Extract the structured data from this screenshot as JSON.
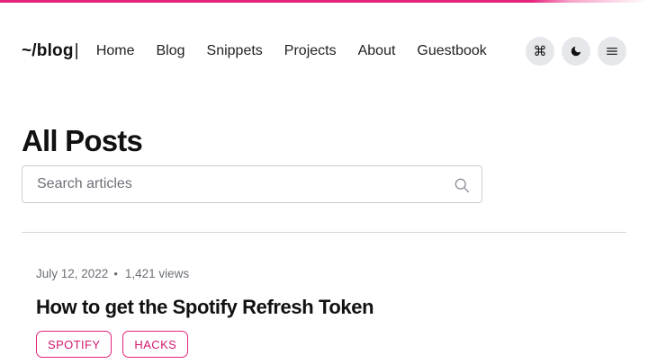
{
  "header": {
    "logo_text": "~/blog",
    "logo_cursor": "|",
    "nav": [
      "Home",
      "Blog",
      "Snippets",
      "Projects",
      "About",
      "Guestbook"
    ],
    "icons": {
      "command": "command-icon",
      "theme": "moon-icon",
      "menu": "hamburger-menu-icon"
    }
  },
  "main": {
    "title": "All Posts",
    "search": {
      "placeholder": "Search articles",
      "value": ""
    },
    "posts": [
      {
        "date": "July 12, 2022",
        "separator": "•",
        "views": "1,421 views",
        "title": "How to get the Spotify Refresh Token",
        "tags": [
          "SPOTIFY",
          "HACKS"
        ]
      }
    ]
  },
  "colors": {
    "accent": "#e4237d",
    "icon_button_bg": "#e5e7eb",
    "text": "#111111",
    "muted": "#6b6f76"
  }
}
